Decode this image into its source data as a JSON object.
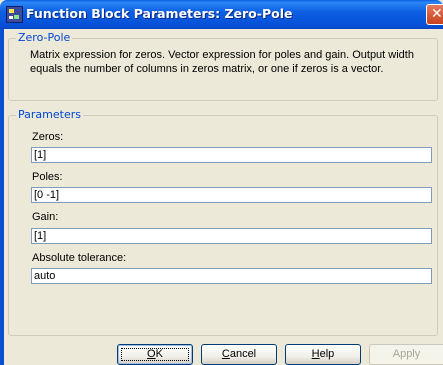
{
  "window": {
    "title": "Function Block Parameters: Zero-Pole",
    "close_glyph": "✕"
  },
  "block_group": {
    "legend": "Zero-Pole",
    "description": "Matrix expression for zeros.  Vector expression for poles and gain.  Output width equals the number of columns in zeros matrix, or one if zeros is a vector."
  },
  "params_group": {
    "legend": "Parameters",
    "fields": [
      {
        "label": "Zeros:",
        "value": "[1]"
      },
      {
        "label": "Poles:",
        "value": "[0 -1]"
      },
      {
        "label": "Gain:",
        "value": "[1]"
      },
      {
        "label": "Absolute tolerance:",
        "value": "auto"
      }
    ]
  },
  "buttons": {
    "ok": {
      "accel": "O",
      "rest": "K"
    },
    "cancel": {
      "accel": "C",
      "rest": "ancel"
    },
    "help": {
      "accel": "H",
      "rest": "elp"
    },
    "apply": {
      "label": "Apply",
      "enabled": false
    }
  },
  "colors": {
    "titlebar": "#0a5fe0",
    "dialog_bg": "#ece9d8",
    "legend_text": "#0046d5",
    "close_button": "#c8421f"
  },
  "icons": {
    "app": "simulink-block-icon",
    "close": "close-icon"
  }
}
